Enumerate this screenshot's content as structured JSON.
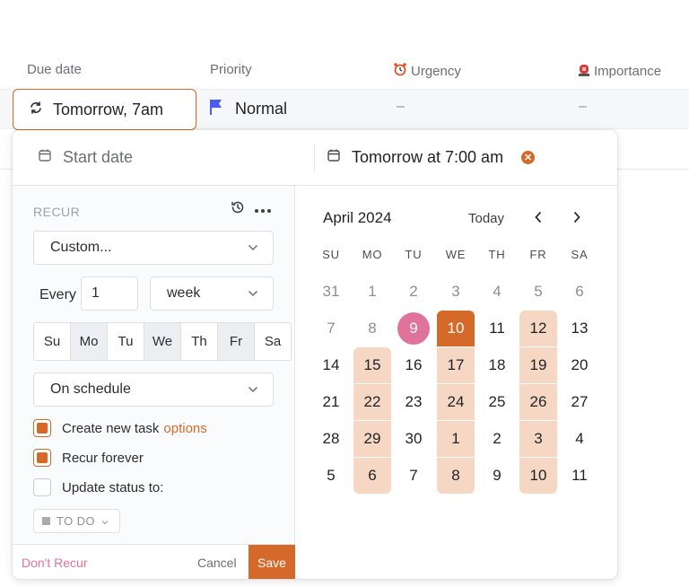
{
  "table": {
    "headers": [
      {
        "label": "Due date",
        "icon": ""
      },
      {
        "label": "Priority",
        "icon": ""
      },
      {
        "label": "Urgency",
        "icon": "alarm-clock-icon"
      },
      {
        "label": "Importance",
        "icon": "siren-icon"
      }
    ],
    "row": {
      "due": "Tomorrow, 7am",
      "priority": "Normal",
      "urgency": "–",
      "importance": "–"
    }
  },
  "popup": {
    "start_placeholder": "Start date",
    "end_value": "Tomorrow at 7:00 am",
    "recur": {
      "label": "RECUR",
      "frequency": "Custom...",
      "every_label": "Every",
      "every_value": "1",
      "unit": "week",
      "days": [
        {
          "label": "Su",
          "selected": false
        },
        {
          "label": "Mo",
          "selected": true
        },
        {
          "label": "Tu",
          "selected": false
        },
        {
          "label": "We",
          "selected": true
        },
        {
          "label": "Th",
          "selected": false
        },
        {
          "label": "Fr",
          "selected": true
        },
        {
          "label": "Sa",
          "selected": false
        }
      ],
      "schedule": "On schedule",
      "create_new_task": "Create new task",
      "options": "options",
      "recur_forever": "Recur forever",
      "update_status": "Update status to:",
      "status": "TO DO",
      "dont_recur": "Don't Recur",
      "cancel": "Cancel",
      "save": "Save"
    },
    "calendar": {
      "month": "April 2024",
      "today_label": "Today",
      "weekdays": [
        "SU",
        "MO",
        "TU",
        "WE",
        "TH",
        "FR",
        "SA"
      ],
      "weeks": [
        [
          "31",
          "1",
          "2",
          "3",
          "4",
          "5",
          "6"
        ],
        [
          "7",
          "8",
          "9",
          "10",
          "11",
          "12",
          "13"
        ],
        [
          "14",
          "15",
          "16",
          "17",
          "18",
          "19",
          "20"
        ],
        [
          "21",
          "22",
          "23",
          "24",
          "25",
          "26",
          "27"
        ],
        [
          "28",
          "29",
          "30",
          "1",
          "2",
          "3",
          "4"
        ],
        [
          "5",
          "6",
          "7",
          "8",
          "9",
          "10",
          "11"
        ]
      ]
    }
  },
  "colors": {
    "accent": "#d4692a",
    "highlight": "#f5d7c4",
    "today": "#e0739a",
    "flag": "#4a5cf0"
  }
}
